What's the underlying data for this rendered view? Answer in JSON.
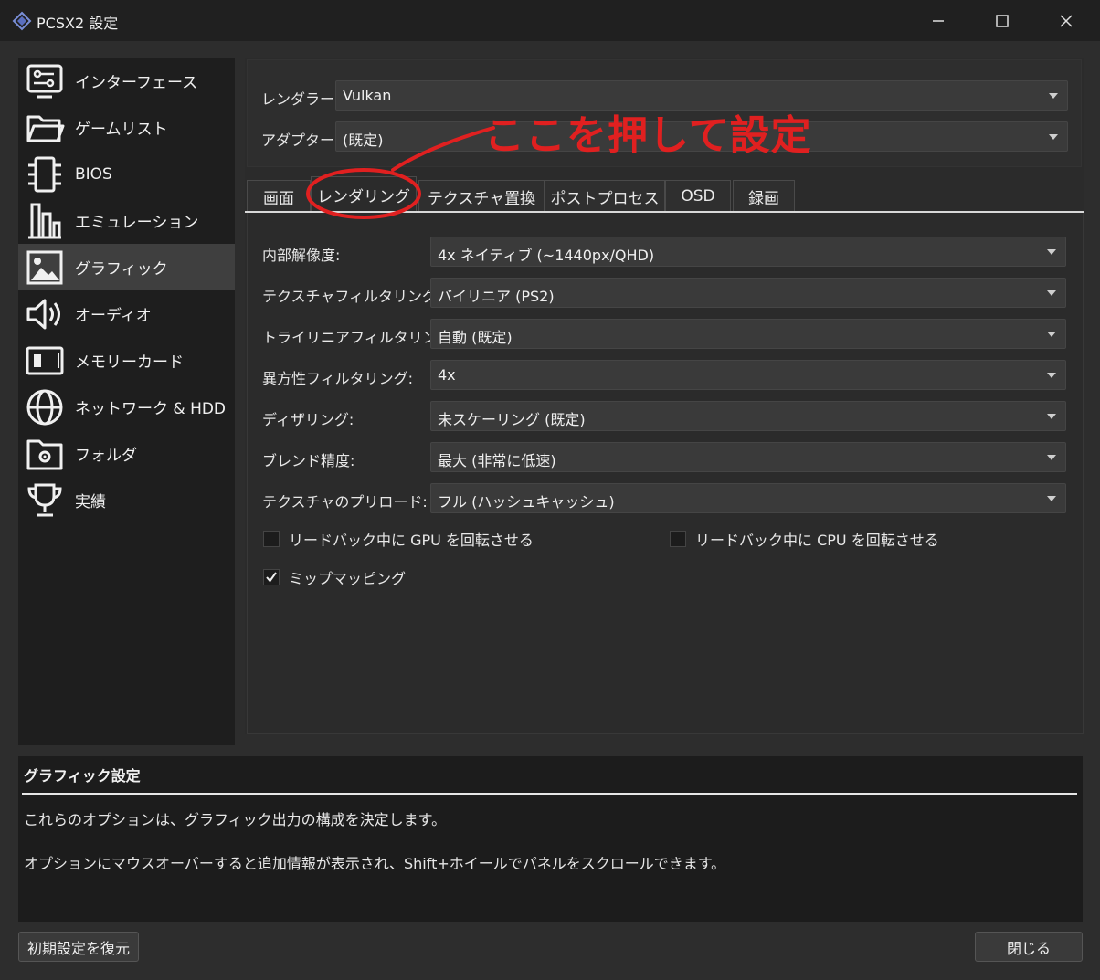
{
  "window": {
    "title": "PCSX2 設定"
  },
  "sidebar": {
    "items": [
      {
        "label": "インターフェース",
        "icon": "interface-icon"
      },
      {
        "label": "ゲームリスト",
        "icon": "folder-icon"
      },
      {
        "label": "BIOS",
        "icon": "chip-icon"
      },
      {
        "label": "エミュレーション",
        "icon": "emulation-icon"
      },
      {
        "label": "グラフィック",
        "icon": "image-icon",
        "active": true
      },
      {
        "label": "オーディオ",
        "icon": "speaker-icon"
      },
      {
        "label": "メモリーカード",
        "icon": "memory-card-icon"
      },
      {
        "label": "ネットワーク & HDD",
        "icon": "globe-icon"
      },
      {
        "label": "フォルダ",
        "icon": "folder-settings-icon"
      },
      {
        "label": "実績",
        "icon": "trophy-icon"
      }
    ]
  },
  "top": {
    "renderer_label": "レンダラー:",
    "renderer_value": "Vulkan",
    "adapter_label": "アダプター:",
    "adapter_value": "(既定)"
  },
  "annotation": {
    "text": "ここを押して設定",
    "color": "#e02020"
  },
  "tabs": [
    {
      "label": "画面"
    },
    {
      "label": "レンダリング",
      "active": true
    },
    {
      "label": "テクスチャ置換"
    },
    {
      "label": "ポストプロセス"
    },
    {
      "label": "OSD"
    },
    {
      "label": "録画"
    }
  ],
  "settings": [
    {
      "label": "内部解像度:",
      "value": "4x ネイティブ (~1440px/QHD)"
    },
    {
      "label": "テクスチャフィルタリング:",
      "value": "バイリニア (PS2)"
    },
    {
      "label": "トライリニアフィルタリング:",
      "value": "自動 (既定)"
    },
    {
      "label": "異方性フィルタリング:",
      "value": "4x"
    },
    {
      "label": "ディザリング:",
      "value": "未スケーリング (既定)"
    },
    {
      "label": "ブレンド精度:",
      "value": "最大 (非常に低速)"
    },
    {
      "label": "テクスチャのプリロード:",
      "value": "フル (ハッシュキャッシュ)"
    }
  ],
  "checkboxes": [
    {
      "label": "リードバック中に GPU を回転させる",
      "checked": false
    },
    {
      "label": "リードバック中に CPU を回転させる",
      "checked": false
    },
    {
      "label": "ミップマッピング",
      "checked": true
    }
  ],
  "description": {
    "title": "グラフィック設定",
    "line1": "これらのオプションは、グラフィック出力の構成を決定します。",
    "line2": "オプションにマウスオーバーすると追加情報が表示され、Shift+ホイールでパネルをスクロールできます。"
  },
  "buttons": {
    "restore_defaults": "初期設定を復元",
    "close": "閉じる"
  }
}
